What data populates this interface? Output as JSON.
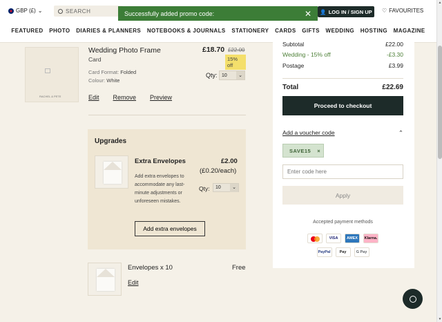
{
  "header": {
    "currency": "GBP (£)",
    "search_placeholder": "SEARCH",
    "toast": "Successfully added promo code:",
    "login": "LOG IN / SIGN UP",
    "favourites": "FAVOURITES",
    "nav": [
      "FEATURED",
      "PHOTO",
      "DIARIES & PLANNERS",
      "NOTEBOOKS & JOURNALS",
      "STATIONERY",
      "CARDS",
      "GIFTS",
      "WEDDING",
      "HOSTING",
      "MAGAZINE"
    ]
  },
  "product": {
    "title": "Wedding Photo Frame",
    "type": "Card",
    "format_label": "Card Format:",
    "format_value": "Folded",
    "colour_label": "Colour:",
    "colour_value": "White",
    "price": "£18.70",
    "was_price": "£22.00",
    "badge": "15% off",
    "qty_label": "Qty:",
    "qty": "10",
    "links": [
      "Edit",
      "Remove",
      "Preview"
    ],
    "thumb_caption": "RACHEL & PETE"
  },
  "upgrades": {
    "title": "Upgrades",
    "name": "Extra Envelopes",
    "price": "£2.00",
    "each": "(£0.20/each)",
    "description": "Add extra envelopes to accommodate any last-minute adjustments or unforeseen mistakes.",
    "qty_label": "Qty:",
    "qty": "10",
    "button": "Add extra envelopes"
  },
  "envelopes": {
    "name": "Envelopes x 10",
    "price": "Free",
    "edit": "Edit"
  },
  "summary": {
    "subtotal_label": "Subtotal",
    "subtotal": "£22.00",
    "discount_label": "Wedding - 15% off",
    "discount": "-£3.30",
    "postage_label": "Postage",
    "postage": "£3.99",
    "total_label": "Total",
    "total": "£22.69",
    "checkout": "Proceed to checkout",
    "voucher": "Add a voucher code",
    "chip": "SAVE15",
    "code_placeholder": "Enter code here",
    "apply": "Apply",
    "payments_label": "Accepted payment methods",
    "payments": [
      "VISA",
      "AMEX",
      "Klarna.",
      "PayPal",
      "Pay",
      "G Pay"
    ]
  },
  "colors": {
    "dark": "#1d2b29",
    "toast_green": "#3c7d37",
    "badge_yellow": "#f4df6b",
    "beige": "#f5f1e8"
  }
}
